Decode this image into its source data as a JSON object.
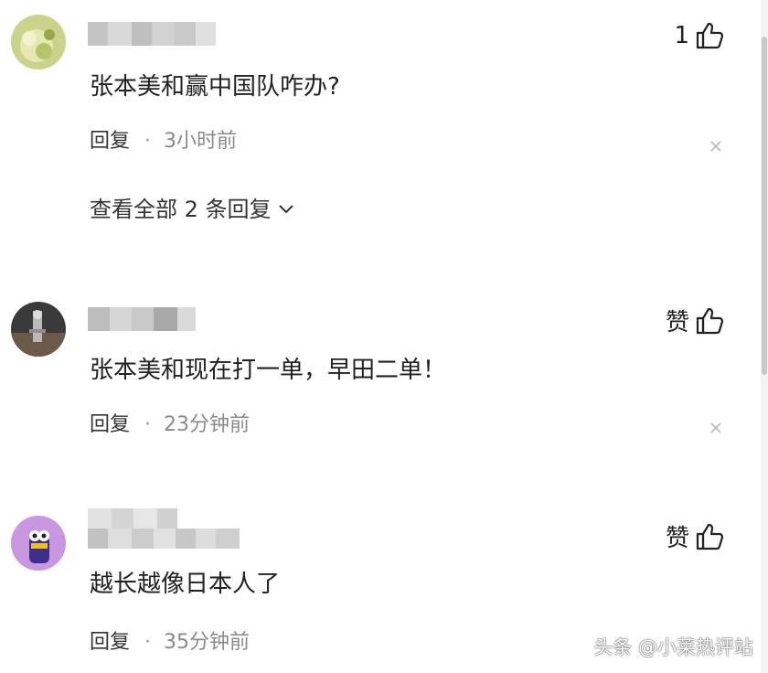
{
  "comments": [
    {
      "like_label": "1",
      "text": "张本美和赢中国队咋办?",
      "reply_label": "回复",
      "separator": "·",
      "time": "3小时前",
      "view_replies_label": "查看全部 2 条回复"
    },
    {
      "like_label": "赞",
      "text": "张本美和现在打一单，早田二单！",
      "reply_label": "回复",
      "separator": "·",
      "time": "23分钟前"
    },
    {
      "like_label": "赞",
      "text": "越长越像日本人了",
      "reply_label": "回复",
      "separator": "·",
      "time": "35分钟前"
    }
  ],
  "icons": {
    "like": "thumbs-up-icon",
    "close": "close-icon",
    "expand": "chevron-down-icon"
  },
  "watermark": "头条 @小莱热评站",
  "colors": {
    "text": "#222222",
    "secondary": "#8a8a8a",
    "background": "#ffffff"
  }
}
